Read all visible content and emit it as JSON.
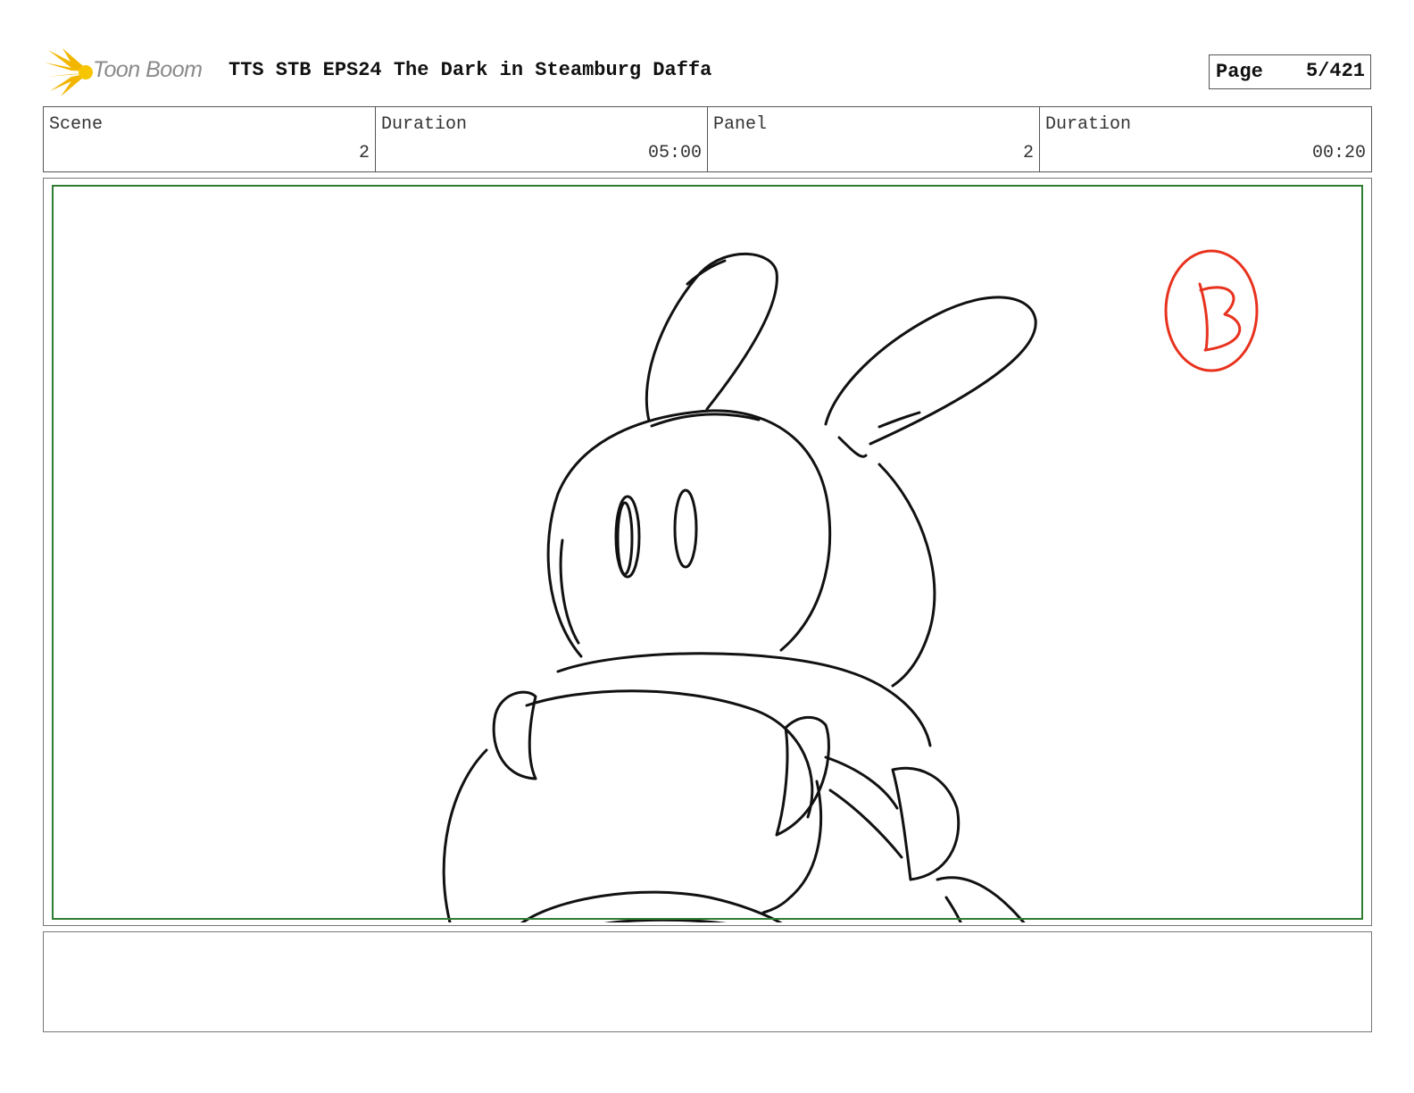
{
  "header": {
    "logo_text": "Toon Boom",
    "title": "TTS STB EPS24 The Dark in Steamburg Daffa",
    "page_label": "Page",
    "page_value": "5/421"
  },
  "info": {
    "scene_label": "Scene",
    "scene_value": "2",
    "scene_duration_label": "Duration",
    "scene_duration_value": "05:00",
    "panel_label": "Panel",
    "panel_value": "2",
    "panel_duration_label": "Duration",
    "panel_duration_value": "00:20"
  },
  "panel": {
    "sketch_subject": "rabbit-character-sketch",
    "annotation_mark": "B",
    "annotation_color": "#e8321e",
    "safe_frame_color": "#2e7d32"
  },
  "caption": {
    "text": ""
  }
}
